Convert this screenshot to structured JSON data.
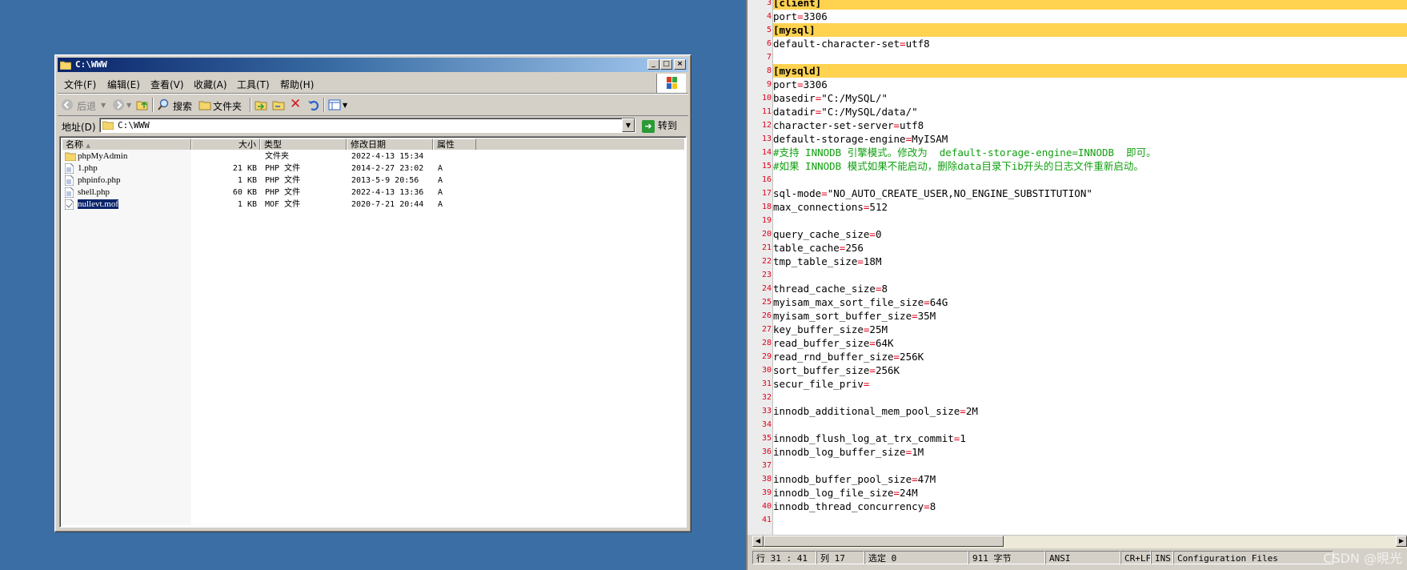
{
  "explorer": {
    "title": "C:\\WWW",
    "menu": [
      "文件(F)",
      "编辑(E)",
      "查看(V)",
      "收藏(A)",
      "工具(T)",
      "帮助(H)"
    ],
    "toolbar": {
      "back": "后退",
      "search": "搜索",
      "folders": "文件夹"
    },
    "address": {
      "label": "地址(D)",
      "value": "C:\\WWW",
      "go": "转到"
    },
    "columns": [
      "名称",
      "大小",
      "类型",
      "修改日期",
      "属性"
    ],
    "files": [
      {
        "name": "phpMyAdmin",
        "size": "",
        "type": "文件夹",
        "date": "2022-4-13 15:34",
        "attr": ""
      },
      {
        "name": "1.php",
        "size": "21 KB",
        "type": "PHP 文件",
        "date": "2014-2-27 23:02",
        "attr": "A"
      },
      {
        "name": "phpinfo.php",
        "size": "1 KB",
        "type": "PHP 文件",
        "date": "2013-5-9 20:56",
        "attr": "A"
      },
      {
        "name": "shell.php",
        "size": "60 KB",
        "type": "PHP 文件",
        "date": "2022-4-13 13:36",
        "attr": "A"
      },
      {
        "name": "nullevt.mof",
        "size": "1 KB",
        "type": "MOF 文件",
        "date": "2020-7-21 20:44",
        "attr": "A"
      }
    ]
  },
  "editor": {
    "lines": [
      {
        "n": "3",
        "text": "[client]",
        "hl": true
      },
      {
        "n": "4",
        "text": "port=3306"
      },
      {
        "n": "5",
        "text": "[mysql]",
        "hl": true
      },
      {
        "n": "6",
        "text": "default-character-set=utf8"
      },
      {
        "n": "7",
        "text": ""
      },
      {
        "n": "8",
        "text": "[mysqld]",
        "hl": true
      },
      {
        "n": "9",
        "text": "port=3306"
      },
      {
        "n": "10",
        "text": "basedir=\"C:/MySQL/\""
      },
      {
        "n": "11",
        "text": "datadir=\"C:/MySQL/data/\""
      },
      {
        "n": "12",
        "text": "character-set-server=utf8"
      },
      {
        "n": "13",
        "text": "default-storage-engine=MyISAM"
      },
      {
        "n": "14",
        "text": "#支持 INNODB 引擎模式。修改为  default-storage-engine=INNODB  即可。",
        "comment": true
      },
      {
        "n": "15",
        "text": "#如果 INNODB 模式如果不能启动，删除data目录下ib开头的日志文件重新启动。",
        "comment": true
      },
      {
        "n": "16",
        "text": ""
      },
      {
        "n": "17",
        "text": "sql-mode=\"NO_AUTO_CREATE_USER,NO_ENGINE_SUBSTITUTION\""
      },
      {
        "n": "18",
        "text": "max_connections=512"
      },
      {
        "n": "19",
        "text": ""
      },
      {
        "n": "20",
        "text": "query_cache_size=0"
      },
      {
        "n": "21",
        "text": "table_cache=256"
      },
      {
        "n": "22",
        "text": "tmp_table_size=18M"
      },
      {
        "n": "23",
        "text": ""
      },
      {
        "n": "24",
        "text": "thread_cache_size=8"
      },
      {
        "n": "25",
        "text": "myisam_max_sort_file_size=64G"
      },
      {
        "n": "26",
        "text": "myisam_sort_buffer_size=35M"
      },
      {
        "n": "27",
        "text": "key_buffer_size=25M"
      },
      {
        "n": "28",
        "text": "read_buffer_size=64K"
      },
      {
        "n": "29",
        "text": "read_rnd_buffer_size=256K"
      },
      {
        "n": "30",
        "text": "sort_buffer_size=256K"
      },
      {
        "n": "31",
        "text": "secur_file_priv="
      },
      {
        "n": "32",
        "text": ""
      },
      {
        "n": "33",
        "text": "innodb_additional_mem_pool_size=2M"
      },
      {
        "n": "34",
        "text": ""
      },
      {
        "n": "35",
        "text": "innodb_flush_log_at_trx_commit=1"
      },
      {
        "n": "36",
        "text": "innodb_log_buffer_size=1M"
      },
      {
        "n": "37",
        "text": ""
      },
      {
        "n": "38",
        "text": "innodb_buffer_pool_size=47M"
      },
      {
        "n": "39",
        "text": "innodb_log_file_size=24M"
      },
      {
        "n": "40",
        "text": "innodb_thread_concurrency=8"
      },
      {
        "n": "41",
        "text": ""
      }
    ],
    "status": {
      "position": "行 31 : 41",
      "column": "列 17",
      "selection": "选定 0",
      "bytes": "911 字节",
      "encoding": "ANSI",
      "eol": "CR+LF",
      "mode": "INS",
      "filetype": "Configuration Files"
    }
  },
  "watermark": "CSDN @晛光"
}
